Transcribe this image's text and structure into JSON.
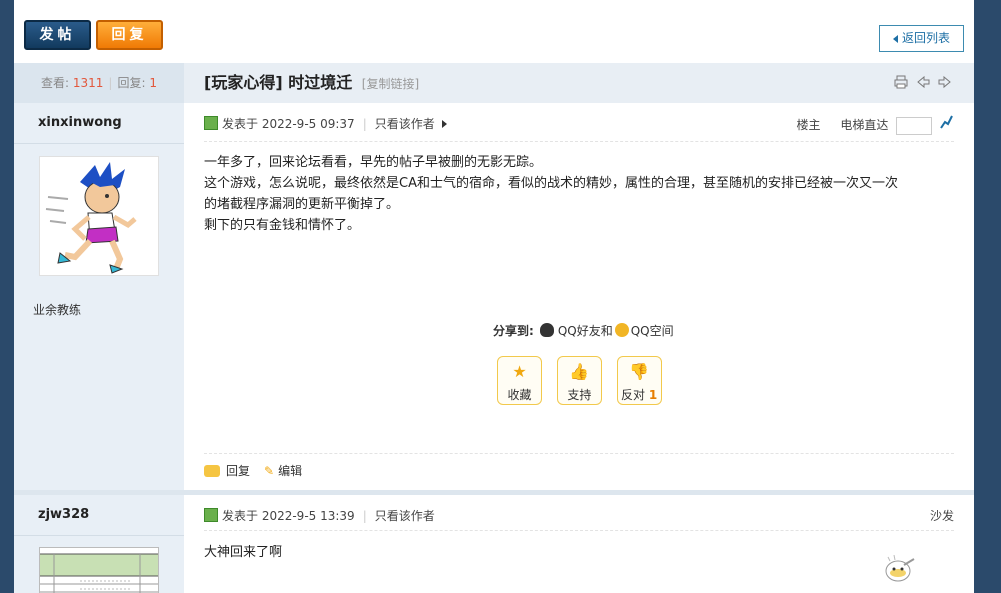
{
  "toolbar": {
    "post_label": "发帖",
    "reply_label": "回复",
    "back_label": "返回列表"
  },
  "thread": {
    "views_label": "查看:",
    "views": "1311",
    "replies_label": "回复:",
    "replies": "1",
    "title": "[玩家心得] 时过境迁",
    "copy_link": "[复制链接]",
    "icons": [
      "printer-icon",
      "prev-thread-icon",
      "next-thread-icon"
    ]
  },
  "posts": [
    {
      "author": "xinxinwong",
      "rank": "业余教练",
      "posted_label": "发表于 2022-9-5 09:37",
      "only_author": "只看该作者",
      "floor": "楼主",
      "elevator": "电梯直达",
      "content": [
        "一年多了，回来论坛看看，早先的帖子早被删的无影无踪。",
        "这个游戏，怎么说呢，最终依然是CA和士气的宿命，看似的战术的精妙，属性的合理，甚至随机的安排已经被一次又一次",
        "的堵截程序漏洞的更新平衡掉了。",
        "剩下的只有金钱和情怀了。"
      ],
      "share_label": "分享到:",
      "share_qq": "QQ好友和",
      "share_qzone": "QQ空间",
      "actions": {
        "favorite": "收藏",
        "support": "支持",
        "oppose": "反对",
        "oppose_count": "1"
      },
      "footer": {
        "reply": "回复",
        "edit": "编辑"
      }
    },
    {
      "author": "zjw328",
      "posted_label": "发表于 2022-9-5 13:39",
      "only_author": "只看该作者",
      "floor": "沙发",
      "content": "大神回来了啊"
    }
  ],
  "colors": {
    "post_button": "#1e4a73",
    "reply_button": "#f5901e",
    "accent": "#1d6fa5",
    "views_number": "#e2573c"
  }
}
